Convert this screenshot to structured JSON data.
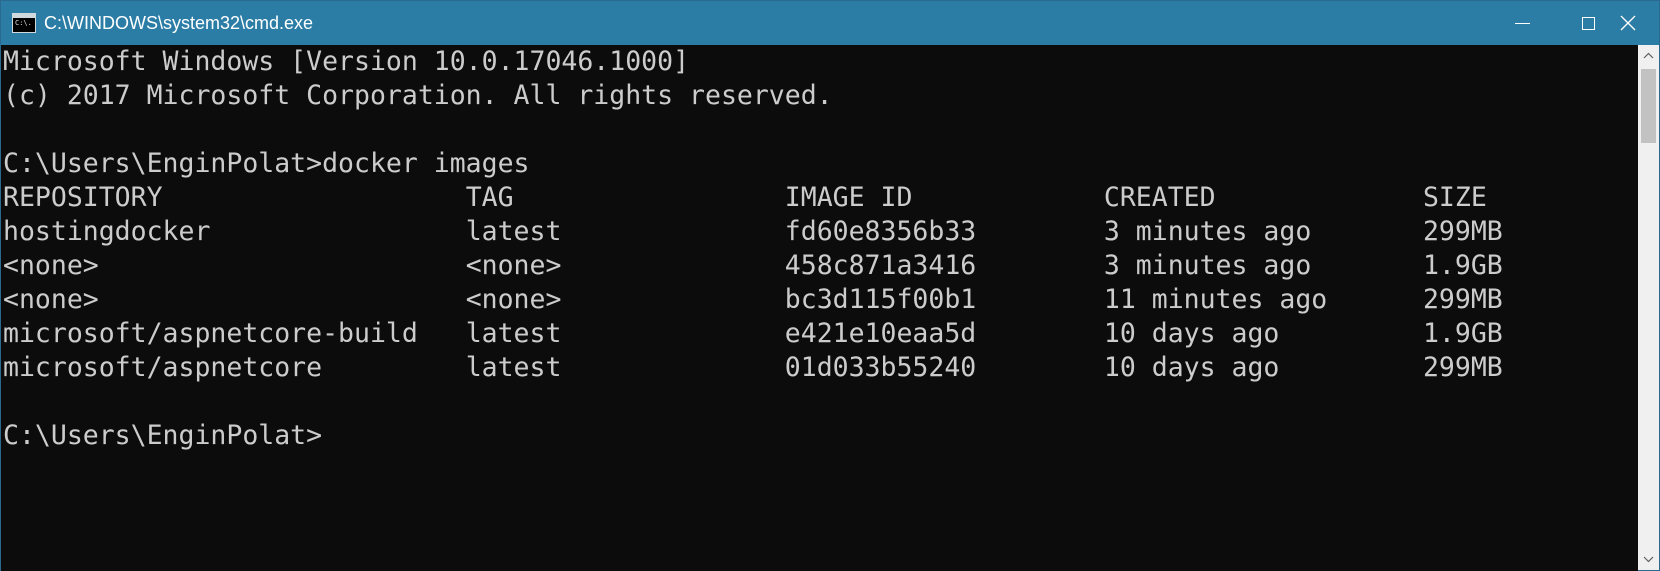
{
  "window": {
    "title": "C:\\WINDOWS\\system32\\cmd.exe",
    "icon_text": "C:\\.",
    "titlebar_color": "#2b7da6",
    "console_bg": "#0c0c0c",
    "console_fg": "#cccccc"
  },
  "controls": {
    "minimize_icon": "minimize-icon",
    "maximize_icon": "maximize-icon",
    "close_icon": "close-icon"
  },
  "console": {
    "banner_line1": "Microsoft Windows [Version 10.0.17046.1000]",
    "banner_line2": "(c) 2017 Microsoft Corporation. All rights reserved.",
    "prompt": "C:\\Users\\EnginPolat>",
    "command": "docker images",
    "final_prompt": "C:\\Users\\EnginPolat>",
    "table": {
      "headers": [
        "REPOSITORY",
        "TAG",
        "IMAGE ID",
        "CREATED",
        "SIZE"
      ],
      "rows": [
        [
          "hostingdocker",
          "latest",
          "fd60e8356b33",
          "3 minutes ago",
          "299MB"
        ],
        [
          "<none>",
          "<none>",
          "458c871a3416",
          "3 minutes ago",
          "1.9GB"
        ],
        [
          "<none>",
          "<none>",
          "bc3d115f00b1",
          "11 minutes ago",
          "299MB"
        ],
        [
          "microsoft/aspnetcore-build",
          "latest",
          "e421e10eaa5d",
          "10 days ago",
          "1.9GB"
        ],
        [
          "microsoft/aspnetcore",
          "latest",
          "01d033b55240",
          "10 days ago",
          "299MB"
        ]
      ]
    }
  }
}
